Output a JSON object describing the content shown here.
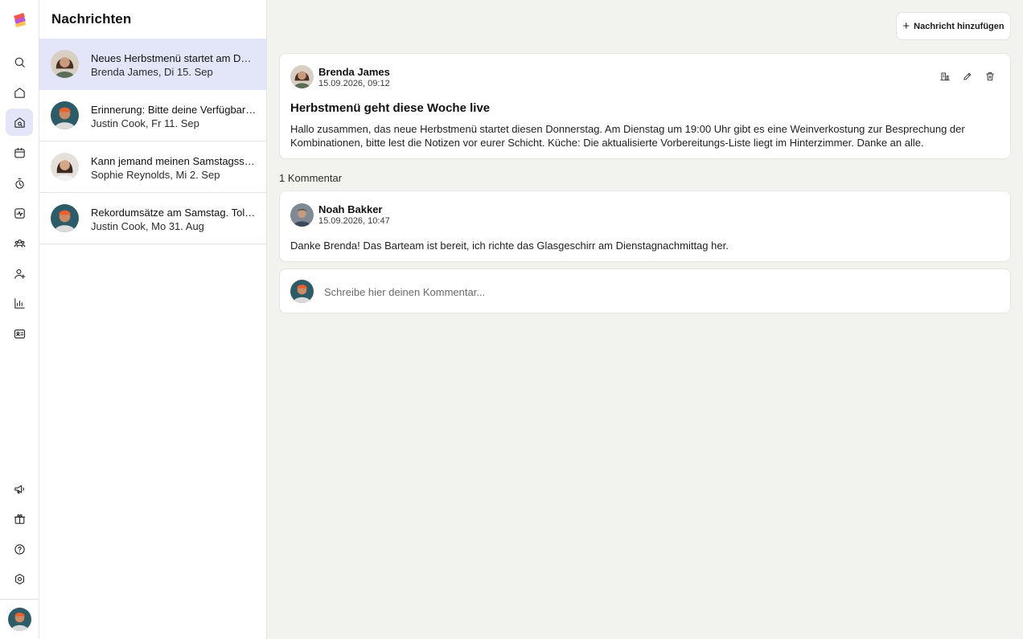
{
  "sidebar": {
    "items": [
      {
        "icon": "search-icon",
        "active": false
      },
      {
        "icon": "home-icon",
        "active": false
      },
      {
        "icon": "messages-icon",
        "active": true
      },
      {
        "icon": "calendar-icon",
        "active": false
      },
      {
        "icon": "timer-icon",
        "active": false
      },
      {
        "icon": "activity-icon",
        "active": false
      },
      {
        "icon": "team-icon",
        "active": false
      },
      {
        "icon": "add-user-icon",
        "active": false
      },
      {
        "icon": "chart-icon",
        "active": false
      },
      {
        "icon": "id-card-icon",
        "active": false
      }
    ],
    "bottom_items": [
      {
        "icon": "megaphone-icon"
      },
      {
        "icon": "gift-icon"
      },
      {
        "icon": "help-icon"
      },
      {
        "icon": "settings-icon"
      }
    ],
    "accent_color": "#e3e6f9"
  },
  "list": {
    "title": "Nachrichten",
    "items": [
      {
        "subject": "Neues Herbstmenü startet am Donnerstag",
        "meta": "Brenda James, Di 15. Sep",
        "avatar": "brenda",
        "selected": true
      },
      {
        "subject": "Erinnerung: Bitte deine Verfügbarkeit eintragen",
        "meta": "Justin Cook, Fr 11. Sep",
        "avatar": "justin",
        "selected": false
      },
      {
        "subject": "Kann jemand meinen Samstagsschicht übernehmen?",
        "meta": "Sophie Reynolds, Mi 2. Sep",
        "avatar": "sophie",
        "selected": false
      },
      {
        "subject": "Rekordumsätze am Samstag. Tolle Arbeit, Team!",
        "meta": "Justin Cook, Mo 31. Aug",
        "avatar": "justin",
        "selected": false
      }
    ]
  },
  "toolbar": {
    "add_icon": "+",
    "add_label": "Nachricht hinzufügen"
  },
  "post": {
    "author": "Brenda James",
    "timestamp": "15.09.2026, 09:12",
    "title": "Herbstmenü geht diese Woche live",
    "body": "Hallo zusammen, das neue Herbstmenü startet diesen Donnerstag. Am Dienstag um 19:00 Uhr gibt es eine Weinverkostung zur Besprechung der Kombinationen, bitte lest die Notizen vor eurer Schicht. Küche: Die aktualisierte Vorbereitungs-Liste liegt im Hinterzimmer. Danke an alle.",
    "actions": [
      "translate-icon",
      "edit-icon",
      "delete-icon"
    ]
  },
  "comments": {
    "count_label": "1 Kommentar",
    "items": [
      {
        "author": "Noah Bakker",
        "timestamp": "15.09.2026, 10:47",
        "text": "Danke Brenda! Das Barteam ist bereit, ich richte das Glasgeschirr am Dienstagnachmittag her."
      }
    ]
  },
  "composer": {
    "placeholder": "Schreibe hier deinen Kommentar..."
  }
}
